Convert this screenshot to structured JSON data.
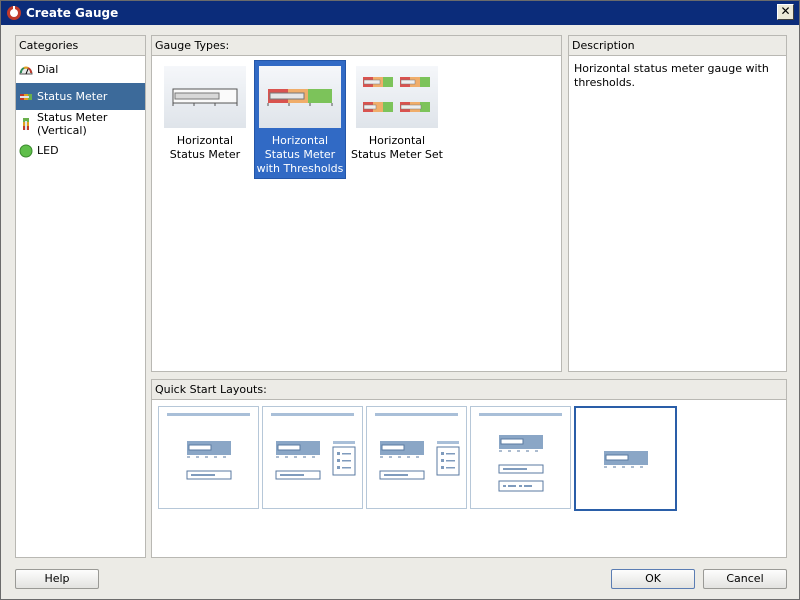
{
  "window": {
    "title": "Create Gauge",
    "close_glyph": "✕"
  },
  "categories": {
    "header": "Categories",
    "items": [
      {
        "label": "Dial",
        "icon": "dial-icon"
      },
      {
        "label": "Status Meter",
        "icon": "status-meter-icon",
        "selected": true
      },
      {
        "label": "Status Meter (Vertical)",
        "icon": "status-meter-vertical-icon"
      },
      {
        "label": "LED",
        "icon": "led-icon"
      }
    ]
  },
  "gauge_types": {
    "header": "Gauge Types:",
    "items": [
      {
        "line1": "Horizontal",
        "line2": "Status Meter",
        "line3": ""
      },
      {
        "line1": "Horizontal",
        "line2": "Status Meter",
        "line3": "with Thresholds",
        "selected": true
      },
      {
        "line1": "Horizontal",
        "line2": "Status Meter Set",
        "line3": ""
      }
    ]
  },
  "description": {
    "header": "Description",
    "text": "Horizontal status meter gauge with thresholds."
  },
  "quick_start": {
    "header": "Quick Start Layouts:",
    "selected_index": 4
  },
  "buttons": {
    "help": "Help",
    "ok": "OK",
    "cancel": "Cancel"
  },
  "colors": {
    "selection": "#316ac5",
    "category_selection": "#3c6a9a",
    "title_bar": "#0b2c7a"
  }
}
